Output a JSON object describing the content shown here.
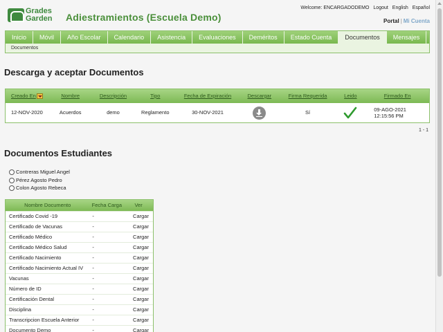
{
  "header": {
    "logo_line1": "Grades",
    "logo_line2": "Garden",
    "title": "Adiestramientos (Escuela Demo)",
    "welcome": "Welcome: ENCARGADODEMO",
    "logout": "Logout",
    "english": "English",
    "espanol": "Español",
    "portal": "Portal",
    "separator": "|",
    "mi_cuenta": "Mi Cuenta"
  },
  "nav": {
    "tabs": [
      "Inicio",
      "Móvil",
      "Año Escolar",
      "Calendario",
      "Asistencia",
      "Evaluaciones",
      "Deméritos",
      "Estado Cuenta",
      "Documentos",
      "Mensajes"
    ],
    "active": "Documentos",
    "subnav": "Documentos"
  },
  "docs_section": {
    "title": "Descarga y aceptar Documentos",
    "columns": [
      "Creado En",
      "Nombre",
      "Descripción",
      "Tipo",
      "Fecha de Expiración",
      "Descargar",
      "Firma Requerida",
      "Leido",
      "Firmado En"
    ],
    "rows": [
      {
        "creado": "12-NOV-2020",
        "nombre": "Acuerdos",
        "descripcion": "demo",
        "tipo": "Reglamento",
        "expiracion": "30-NOV-2021",
        "descargar_icon": "download-icon",
        "firma": "Sí",
        "leido_icon": "check-icon",
        "firmado_date": "09-AGO-2021",
        "firmado_time": "12:15:56 PM"
      }
    ],
    "pager": "1 - 1"
  },
  "students_section": {
    "title": "Documentos Estudiantes",
    "students": [
      "Contreras Miguel Angel",
      "Pérez Agosto Pedro",
      "Colon Agosto Rebeca"
    ],
    "columns": [
      "Nombre Documento",
      "Fecha Carga",
      "Ver"
    ],
    "rows": [
      {
        "nombre": "Certificado Covid -19",
        "fecha": "-",
        "ver": "Cargar"
      },
      {
        "nombre": "Certificado de Vacunas",
        "fecha": "-",
        "ver": "Cargar"
      },
      {
        "nombre": "Certificado Médico",
        "fecha": "-",
        "ver": "Cargar"
      },
      {
        "nombre": "Certificado Médico Salud",
        "fecha": "-",
        "ver": "Cargar"
      },
      {
        "nombre": "Certificado Nacimiento",
        "fecha": "-",
        "ver": "Cargar"
      },
      {
        "nombre": "Certificado Nacimiento Actual IV",
        "fecha": "-",
        "ver": "Cargar"
      },
      {
        "nombre": "Vacunas",
        "fecha": "-",
        "ver": "Cargar"
      },
      {
        "nombre": "Número de ID",
        "fecha": "-",
        "ver": "Cargar"
      },
      {
        "nombre": "Certificación Dental",
        "fecha": "-",
        "ver": "Cargar"
      },
      {
        "nombre": "Disciplina",
        "fecha": "-",
        "ver": "Cargar"
      },
      {
        "nombre": "Transcripcion Escuela Anterior",
        "fecha": "-",
        "ver": "Cargar"
      },
      {
        "nombre": "Documento Demo",
        "fecha": "-",
        "ver": "Cargar"
      }
    ]
  },
  "colors": {
    "brand_green": "#4a8f3a",
    "tab_green": "#78b84e",
    "link_blue": "#7fa7c9"
  }
}
